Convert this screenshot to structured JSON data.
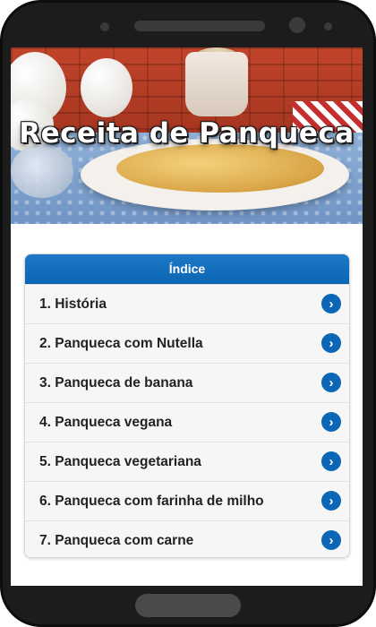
{
  "banner": {
    "title": "Receita de Panqueca"
  },
  "index": {
    "header": "Índice",
    "items": [
      {
        "label": "1. História"
      },
      {
        "label": "2. Panqueca com Nutella"
      },
      {
        "label": "3. Panqueca de banana"
      },
      {
        "label": "4. Panqueca vegana"
      },
      {
        "label": "5. Panqueca vegetariana"
      },
      {
        "label": "6. Panqueca com farinha de milho"
      },
      {
        "label": "7. Panqueca com carne"
      }
    ]
  },
  "colors": {
    "accent": "#0b66b5",
    "header_gradient_top": "#1d79c6",
    "phone_frame": "#1c1c1c"
  },
  "icons": {
    "item_arrow": "chevron-right-circle-icon"
  }
}
